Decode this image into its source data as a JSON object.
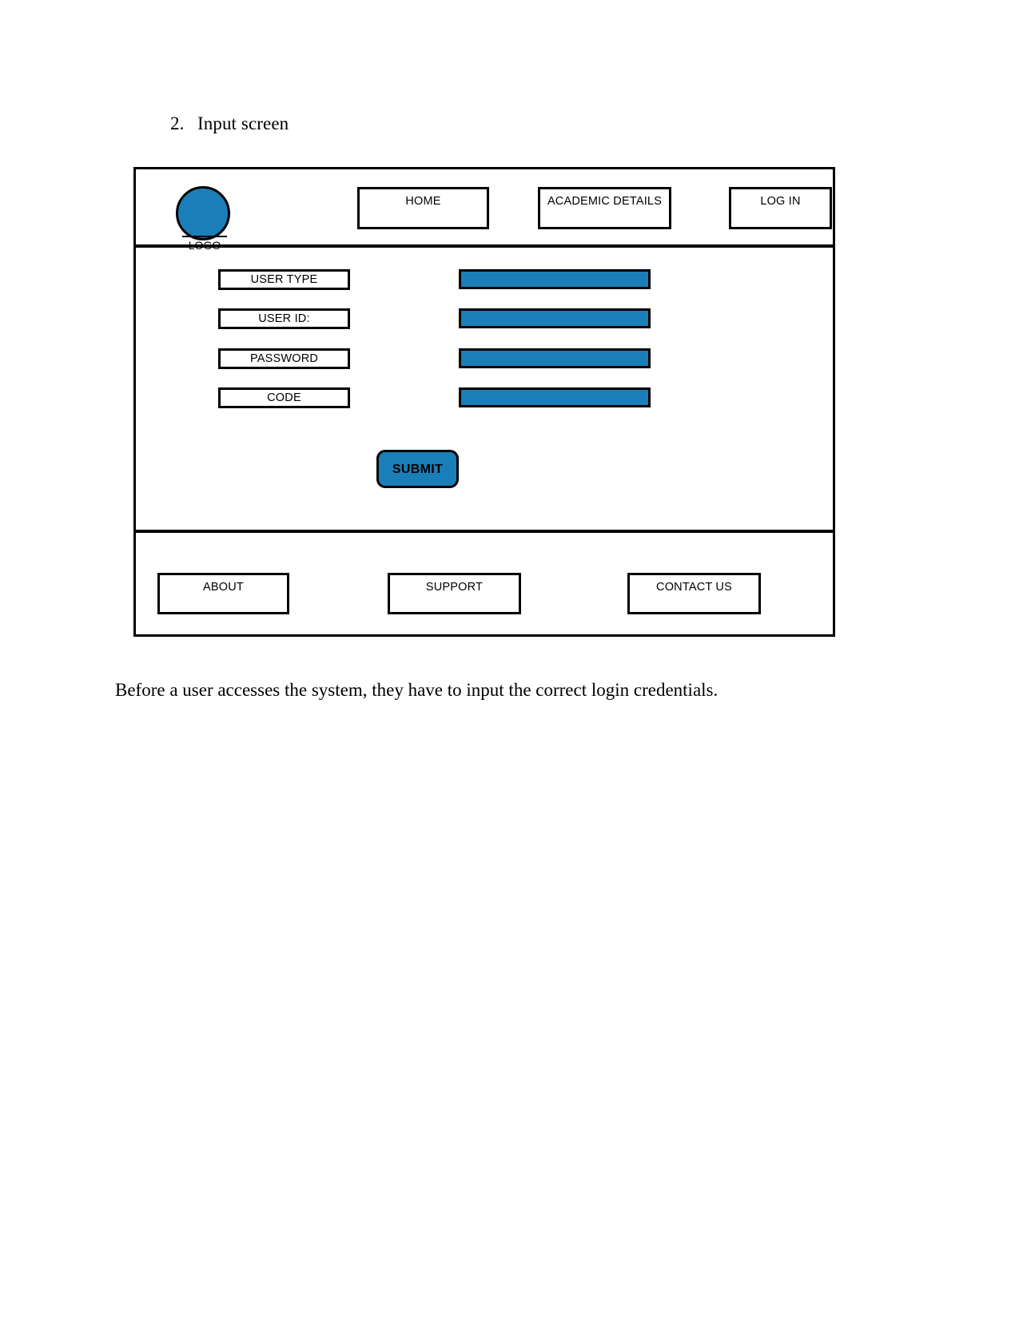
{
  "document": {
    "heading_number": "2.",
    "heading_text": "Input screen",
    "caption": "Before a user accesses the system, they have to input the correct login credentials."
  },
  "colors": {
    "accent_blue": "#1a7fb8",
    "outline_black": "#000000",
    "page_background": "#ffffff"
  },
  "wireframe": {
    "header": {
      "logo": {
        "icon": "circle-logo-icon",
        "label": "LOGO"
      },
      "nav_items": [
        {
          "label": "HOME"
        },
        {
          "label": "ACADEMIC DETAILS"
        },
        {
          "label": "LOG IN"
        }
      ]
    },
    "form": {
      "fields": [
        {
          "label": "USER TYPE",
          "value": "",
          "placeholder": ""
        },
        {
          "label": "USER ID:",
          "value": "",
          "placeholder": ""
        },
        {
          "label": "PASSWORD",
          "value": "",
          "placeholder": ""
        },
        {
          "label": "CODE",
          "value": "",
          "placeholder": ""
        }
      ],
      "submit_label": "SUBMIT"
    },
    "footer": {
      "links": [
        {
          "label": "ABOUT"
        },
        {
          "label": "SUPPORT"
        },
        {
          "label": "CONTACT US"
        }
      ]
    }
  }
}
